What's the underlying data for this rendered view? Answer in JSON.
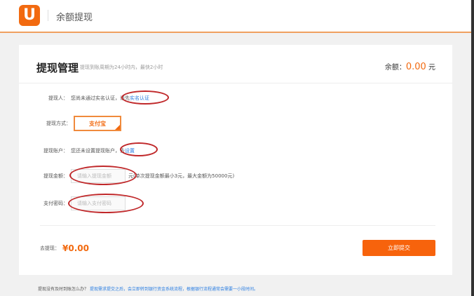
{
  "header": {
    "logo": "U",
    "title": "余额提现"
  },
  "card": {
    "title": "提现管理",
    "subtitle": "提现到账周期为24小时内，最快2小时",
    "balance_label": "余额：",
    "balance_value": "0.00",
    "balance_unit": "元"
  },
  "form": {
    "payee": {
      "label": "提现人：",
      "text": "您尚未通过实名认证，请先",
      "link": "实名认证"
    },
    "method": {
      "label": "提现方式：",
      "value": "支付宝"
    },
    "account": {
      "label": "提现账户：",
      "text": "您还未设置提现账户，去",
      "link": "设置"
    },
    "amount": {
      "label": "提现金额：",
      "placeholder": "请输入提现金额",
      "hint": "元(单次提现金额最小3元，最大金额为50000元)"
    },
    "password": {
      "label": "支付密码：",
      "placeholder": "请输入支付密码"
    }
  },
  "summary": {
    "label": "去提现：",
    "value": "¥0.00",
    "submit": "立即提交"
  },
  "footer": {
    "question": "提现没有及时到账怎么办？",
    "answer": "提现需求提交之后，会立即转到银行资金系统流程，根据银行流程通常会需要一小段时间。"
  },
  "colors": {
    "accent": "#f7630c",
    "link": "#2a7de1",
    "annotation": "#c0282a"
  }
}
